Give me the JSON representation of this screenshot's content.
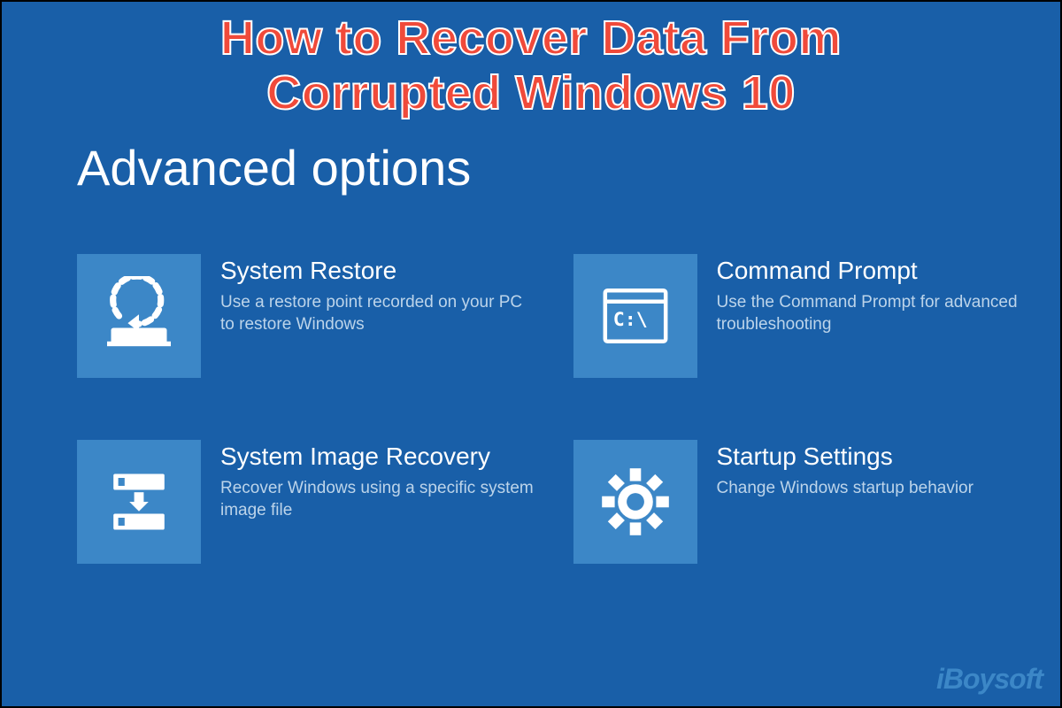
{
  "overlay": {
    "line1": "How to Recover Data From",
    "line2": "Corrupted Windows 10"
  },
  "heading": "Advanced options",
  "options": [
    {
      "title": "System Restore",
      "desc": "Use a restore point recorded on your PC to restore Windows"
    },
    {
      "title": "Command Prompt",
      "desc": "Use the Command Prompt for advanced troubleshooting"
    },
    {
      "title": "System Image Recovery",
      "desc": "Recover Windows using a specific system image file"
    },
    {
      "title": "Startup Settings",
      "desc": "Change Windows startup behavior"
    }
  ],
  "watermark": "iBoysoft",
  "colors": {
    "bg": "#195fa8",
    "tile": "#3c87c7",
    "accent": "#f04a3a"
  }
}
